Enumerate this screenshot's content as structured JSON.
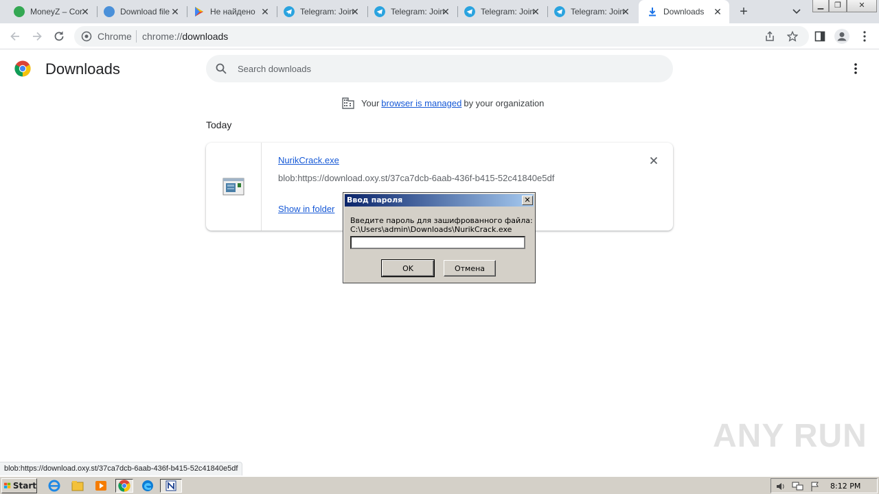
{
  "tabs": [
    {
      "title": "MoneyZ – Cor",
      "favicon_color": "#34a853",
      "favicon": "moneyz-icon"
    },
    {
      "title": "Download file",
      "favicon_color": "#4a90d9",
      "favicon": "download-site-icon"
    },
    {
      "title": "Не найдено",
      "favicon_color": "#ea4335",
      "favicon": "google-play-icon"
    },
    {
      "title": "Telegram: Join",
      "favicon_color": "#2aa3df",
      "favicon": "telegram-icon"
    },
    {
      "title": "Telegram: Join",
      "favicon_color": "#2aa3df",
      "favicon": "telegram-icon"
    },
    {
      "title": "Telegram: Join",
      "favicon_color": "#2aa3df",
      "favicon": "telegram-icon"
    },
    {
      "title": "Telegram: Join",
      "favicon_color": "#2aa3df",
      "favicon": "telegram-icon"
    },
    {
      "title": "Downloads",
      "favicon_color": "#1a73e8",
      "favicon": "download-icon",
      "active": true
    }
  ],
  "omnibox": {
    "site_label": "Chrome",
    "url_scheme": "chrome://",
    "url_host": "downloads"
  },
  "page": {
    "title": "Downloads",
    "search_placeholder": "Search downloads",
    "managed_prefix": "Your",
    "managed_link": "browser is managed",
    "managed_suffix": "by your organization",
    "section_today": "Today"
  },
  "download_item": {
    "filename": "NurikCrack.exe",
    "url": "blob:https://download.oxy.st/37ca7dcb-6aab-436f-b415-52c41840e5df",
    "show_in_folder": "Show in folder"
  },
  "dialog": {
    "title": "Ввод пароля",
    "message_line1": "Введите пароль для зашифрованного файла:",
    "message_line2": "C:\\Users\\admin\\Downloads\\NurikCrack.exe",
    "password_value": "",
    "ok_label": "OK",
    "cancel_label": "Отмена"
  },
  "status_bar": {
    "text": "blob:https://download.oxy.st/37ca7dcb-6aab-436f-b415-52c41840e5df"
  },
  "watermark": "ANY RUN",
  "taskbar": {
    "start_label": "Start",
    "clock": "8:12 PM"
  },
  "colors": {
    "link": "#1558d6",
    "accent": "#1a73e8",
    "dialog_title_start": "#0a246a",
    "dialog_title_end": "#a6caf0"
  }
}
